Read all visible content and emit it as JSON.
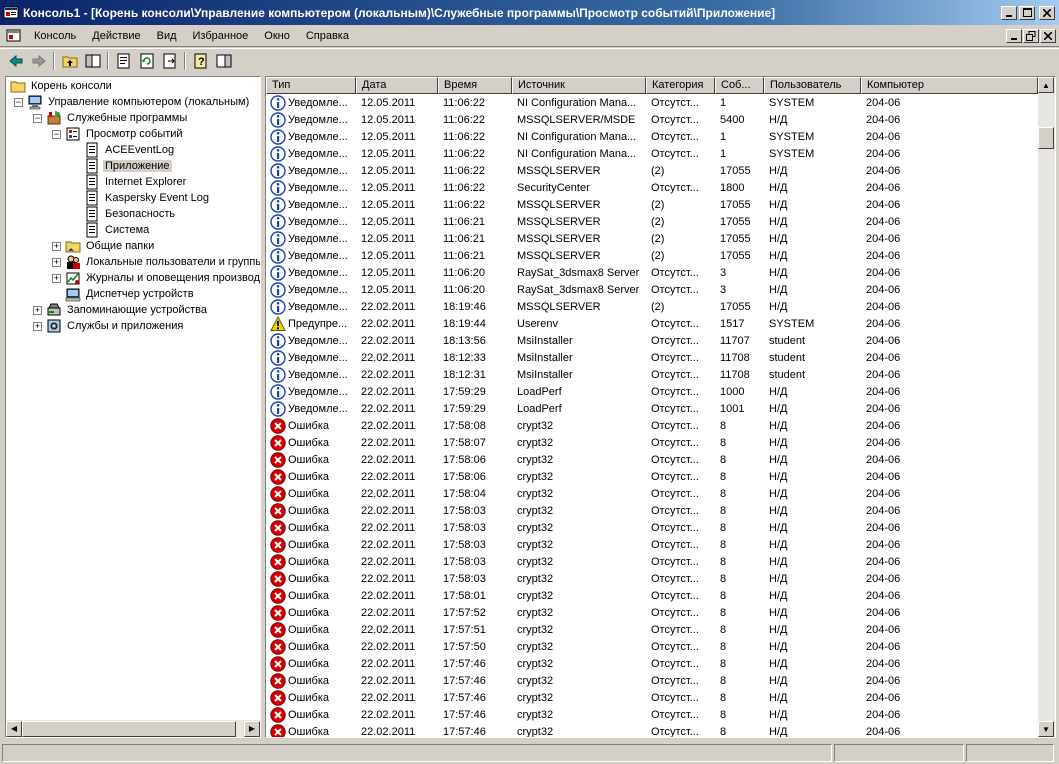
{
  "window": {
    "title": "Консоль1 - [Корень консоли\\Управление компьютером (локальным)\\Служебные программы\\Просмотр событий\\Приложение]"
  },
  "menu": [
    "Консоль",
    "Действие",
    "Вид",
    "Избранное",
    "Окно",
    "Справка"
  ],
  "tree": [
    {
      "label": "Корень консоли",
      "level": 0,
      "expander": "",
      "icon": "folder-icon"
    },
    {
      "label": "Управление компьютером (локальным)",
      "level": 1,
      "expander": "−",
      "icon": "computer-management-icon"
    },
    {
      "label": "Служебные программы",
      "level": 2,
      "expander": "−",
      "icon": "tools-icon"
    },
    {
      "label": "Просмотр событий",
      "level": 3,
      "expander": "−",
      "icon": "event-viewer-icon"
    },
    {
      "label": "ACEEventLog",
      "level": 4,
      "expander": "",
      "icon": "log-icon"
    },
    {
      "label": "Приложение",
      "level": 4,
      "expander": "",
      "icon": "log-icon",
      "selected": true
    },
    {
      "label": "Internet Explorer",
      "level": 4,
      "expander": "",
      "icon": "log-icon"
    },
    {
      "label": "Kaspersky Event Log",
      "level": 4,
      "expander": "",
      "icon": "log-icon"
    },
    {
      "label": "Безопасность",
      "level": 4,
      "expander": "",
      "icon": "log-icon"
    },
    {
      "label": "Система",
      "level": 4,
      "expander": "",
      "icon": "log-icon"
    },
    {
      "label": "Общие папки",
      "level": 3,
      "expander": "+",
      "icon": "shared-folders-icon"
    },
    {
      "label": "Локальные пользователи и группы",
      "level": 3,
      "expander": "+",
      "icon": "users-icon"
    },
    {
      "label": "Журналы и оповещения производительности",
      "level": 3,
      "expander": "+",
      "icon": "performance-icon"
    },
    {
      "label": "Диспетчер устройств",
      "level": 3,
      "expander": "",
      "icon": "device-manager-icon"
    },
    {
      "label": "Запоминающие устройства",
      "level": 2,
      "expander": "+",
      "icon": "storage-icon"
    },
    {
      "label": "Службы и приложения",
      "level": 2,
      "expander": "+",
      "icon": "services-icon"
    }
  ],
  "columns": [
    "Тип",
    "Дата",
    "Время",
    "Источник",
    "Категория",
    "Соб...",
    "Пользователь",
    "Компьютер"
  ],
  "rows": [
    {
      "kind": "info",
      "type": "Уведомле...",
      "date": "12.05.2011",
      "time": "11:06:22",
      "source": "NI Configuration Mana...",
      "category": "Отсутст...",
      "event": "1",
      "user": "SYSTEM",
      "computer": "204-06"
    },
    {
      "kind": "info",
      "type": "Уведомле...",
      "date": "12.05.2011",
      "time": "11:06:22",
      "source": "MSSQLSERVER/MSDE",
      "category": "Отсутст...",
      "event": "5400",
      "user": "Н/Д",
      "computer": "204-06"
    },
    {
      "kind": "info",
      "type": "Уведомле...",
      "date": "12.05.2011",
      "time": "11:06:22",
      "source": "NI Configuration Mana...",
      "category": "Отсутст...",
      "event": "1",
      "user": "SYSTEM",
      "computer": "204-06"
    },
    {
      "kind": "info",
      "type": "Уведомле...",
      "date": "12.05.2011",
      "time": "11:06:22",
      "source": "NI Configuration Mana...",
      "category": "Отсутст...",
      "event": "1",
      "user": "SYSTEM",
      "computer": "204-06"
    },
    {
      "kind": "info",
      "type": "Уведомле...",
      "date": "12.05.2011",
      "time": "11:06:22",
      "source": "MSSQLSERVER",
      "category": "(2)",
      "event": "17055",
      "user": "Н/Д",
      "computer": "204-06"
    },
    {
      "kind": "info",
      "type": "Уведомле...",
      "date": "12.05.2011",
      "time": "11:06:22",
      "source": "SecurityCenter",
      "category": "Отсутст...",
      "event": "1800",
      "user": "Н/Д",
      "computer": "204-06"
    },
    {
      "kind": "info",
      "type": "Уведомле...",
      "date": "12.05.2011",
      "time": "11:06:22",
      "source": "MSSQLSERVER",
      "category": "(2)",
      "event": "17055",
      "user": "Н/Д",
      "computer": "204-06"
    },
    {
      "kind": "info",
      "type": "Уведомле...",
      "date": "12.05.2011",
      "time": "11:06:21",
      "source": "MSSQLSERVER",
      "category": "(2)",
      "event": "17055",
      "user": "Н/Д",
      "computer": "204-06"
    },
    {
      "kind": "info",
      "type": "Уведомле...",
      "date": "12.05.2011",
      "time": "11:06:21",
      "source": "MSSQLSERVER",
      "category": "(2)",
      "event": "17055",
      "user": "Н/Д",
      "computer": "204-06"
    },
    {
      "kind": "info",
      "type": "Уведомле...",
      "date": "12.05.2011",
      "time": "11:06:21",
      "source": "MSSQLSERVER",
      "category": "(2)",
      "event": "17055",
      "user": "Н/Д",
      "computer": "204-06"
    },
    {
      "kind": "info",
      "type": "Уведомле...",
      "date": "12.05.2011",
      "time": "11:06:20",
      "source": "RaySat_3dsmax8 Server",
      "category": "Отсутст...",
      "event": "3",
      "user": "Н/Д",
      "computer": "204-06"
    },
    {
      "kind": "info",
      "type": "Уведомле...",
      "date": "12.05.2011",
      "time": "11:06:20",
      "source": "RaySat_3dsmax8 Server",
      "category": "Отсутст...",
      "event": "3",
      "user": "Н/Д",
      "computer": "204-06"
    },
    {
      "kind": "info",
      "type": "Уведомле...",
      "date": "22.02.2011",
      "time": "18:19:46",
      "source": "MSSQLSERVER",
      "category": "(2)",
      "event": "17055",
      "user": "Н/Д",
      "computer": "204-06"
    },
    {
      "kind": "warning",
      "type": "Предупре...",
      "date": "22.02.2011",
      "time": "18:19:44",
      "source": "Userenv",
      "category": "Отсутст...",
      "event": "1517",
      "user": "SYSTEM",
      "computer": "204-06"
    },
    {
      "kind": "info",
      "type": "Уведомле...",
      "date": "22.02.2011",
      "time": "18:13:56",
      "source": "MsiInstaller",
      "category": "Отсутст...",
      "event": "11707",
      "user": "student",
      "computer": "204-06"
    },
    {
      "kind": "info",
      "type": "Уведомле...",
      "date": "22.02.2011",
      "time": "18:12:33",
      "source": "MsiInstaller",
      "category": "Отсутст...",
      "event": "11708",
      "user": "student",
      "computer": "204-06"
    },
    {
      "kind": "info",
      "type": "Уведомле...",
      "date": "22.02.2011",
      "time": "18:12:31",
      "source": "MsiInstaller",
      "category": "Отсутст...",
      "event": "11708",
      "user": "student",
      "computer": "204-06"
    },
    {
      "kind": "info",
      "type": "Уведомле...",
      "date": "22.02.2011",
      "time": "17:59:29",
      "source": "LoadPerf",
      "category": "Отсутст...",
      "event": "1000",
      "user": "Н/Д",
      "computer": "204-06"
    },
    {
      "kind": "info",
      "type": "Уведомле...",
      "date": "22.02.2011",
      "time": "17:59:29",
      "source": "LoadPerf",
      "category": "Отсутст...",
      "event": "1001",
      "user": "Н/Д",
      "computer": "204-06"
    },
    {
      "kind": "error",
      "type": "Ошибка",
      "date": "22.02.2011",
      "time": "17:58:08",
      "source": "crypt32",
      "category": "Отсутст...",
      "event": "8",
      "user": "Н/Д",
      "computer": "204-06"
    },
    {
      "kind": "error",
      "type": "Ошибка",
      "date": "22.02.2011",
      "time": "17:58:07",
      "source": "crypt32",
      "category": "Отсутст...",
      "event": "8",
      "user": "Н/Д",
      "computer": "204-06"
    },
    {
      "kind": "error",
      "type": "Ошибка",
      "date": "22.02.2011",
      "time": "17:58:06",
      "source": "crypt32",
      "category": "Отсутст...",
      "event": "8",
      "user": "Н/Д",
      "computer": "204-06"
    },
    {
      "kind": "error",
      "type": "Ошибка",
      "date": "22.02.2011",
      "time": "17:58:06",
      "source": "crypt32",
      "category": "Отсутст...",
      "event": "8",
      "user": "Н/Д",
      "computer": "204-06"
    },
    {
      "kind": "error",
      "type": "Ошибка",
      "date": "22.02.2011",
      "time": "17:58:04",
      "source": "crypt32",
      "category": "Отсутст...",
      "event": "8",
      "user": "Н/Д",
      "computer": "204-06"
    },
    {
      "kind": "error",
      "type": "Ошибка",
      "date": "22.02.2011",
      "time": "17:58:03",
      "source": "crypt32",
      "category": "Отсутст...",
      "event": "8",
      "user": "Н/Д",
      "computer": "204-06"
    },
    {
      "kind": "error",
      "type": "Ошибка",
      "date": "22.02.2011",
      "time": "17:58:03",
      "source": "crypt32",
      "category": "Отсутст...",
      "event": "8",
      "user": "Н/Д",
      "computer": "204-06"
    },
    {
      "kind": "error",
      "type": "Ошибка",
      "date": "22.02.2011",
      "time": "17:58:03",
      "source": "crypt32",
      "category": "Отсутст...",
      "event": "8",
      "user": "Н/Д",
      "computer": "204-06"
    },
    {
      "kind": "error",
      "type": "Ошибка",
      "date": "22.02.2011",
      "time": "17:58:03",
      "source": "crypt32",
      "category": "Отсутст...",
      "event": "8",
      "user": "Н/Д",
      "computer": "204-06"
    },
    {
      "kind": "error",
      "type": "Ошибка",
      "date": "22.02.2011",
      "time": "17:58:03",
      "source": "crypt32",
      "category": "Отсутст...",
      "event": "8",
      "user": "Н/Д",
      "computer": "204-06"
    },
    {
      "kind": "error",
      "type": "Ошибка",
      "date": "22.02.2011",
      "time": "17:58:01",
      "source": "crypt32",
      "category": "Отсутст...",
      "event": "8",
      "user": "Н/Д",
      "computer": "204-06"
    },
    {
      "kind": "error",
      "type": "Ошибка",
      "date": "22.02.2011",
      "time": "17:57:52",
      "source": "crypt32",
      "category": "Отсутст...",
      "event": "8",
      "user": "Н/Д",
      "computer": "204-06"
    },
    {
      "kind": "error",
      "type": "Ошибка",
      "date": "22.02.2011",
      "time": "17:57:51",
      "source": "crypt32",
      "category": "Отсутст...",
      "event": "8",
      "user": "Н/Д",
      "computer": "204-06"
    },
    {
      "kind": "error",
      "type": "Ошибка",
      "date": "22.02.2011",
      "time": "17:57:50",
      "source": "crypt32",
      "category": "Отсутст...",
      "event": "8",
      "user": "Н/Д",
      "computer": "204-06"
    },
    {
      "kind": "error",
      "type": "Ошибка",
      "date": "22.02.2011",
      "time": "17:57:46",
      "source": "crypt32",
      "category": "Отсутст...",
      "event": "8",
      "user": "Н/Д",
      "computer": "204-06"
    },
    {
      "kind": "error",
      "type": "Ошибка",
      "date": "22.02.2011",
      "time": "17:57:46",
      "source": "crypt32",
      "category": "Отсутст...",
      "event": "8",
      "user": "Н/Д",
      "computer": "204-06"
    },
    {
      "kind": "error",
      "type": "Ошибка",
      "date": "22.02.2011",
      "time": "17:57:46",
      "source": "crypt32",
      "category": "Отсутст...",
      "event": "8",
      "user": "Н/Д",
      "computer": "204-06"
    },
    {
      "kind": "error",
      "type": "Ошибка",
      "date": "22.02.2011",
      "time": "17:57:46",
      "source": "crypt32",
      "category": "Отсутст...",
      "event": "8",
      "user": "Н/Д",
      "computer": "204-06"
    },
    {
      "kind": "error",
      "type": "Ошибка",
      "date": "22.02.2011",
      "time": "17:57:46",
      "source": "crypt32",
      "category": "Отсутст...",
      "event": "8",
      "user": "Н/Д",
      "computer": "204-06"
    }
  ],
  "colors": {
    "titlebar_start": "#0a246a",
    "titlebar_end": "#a6caf0",
    "info": "#1f3fae",
    "warning": "#f2d200",
    "error": "#d40000",
    "chrome": "#d4d0c8"
  }
}
